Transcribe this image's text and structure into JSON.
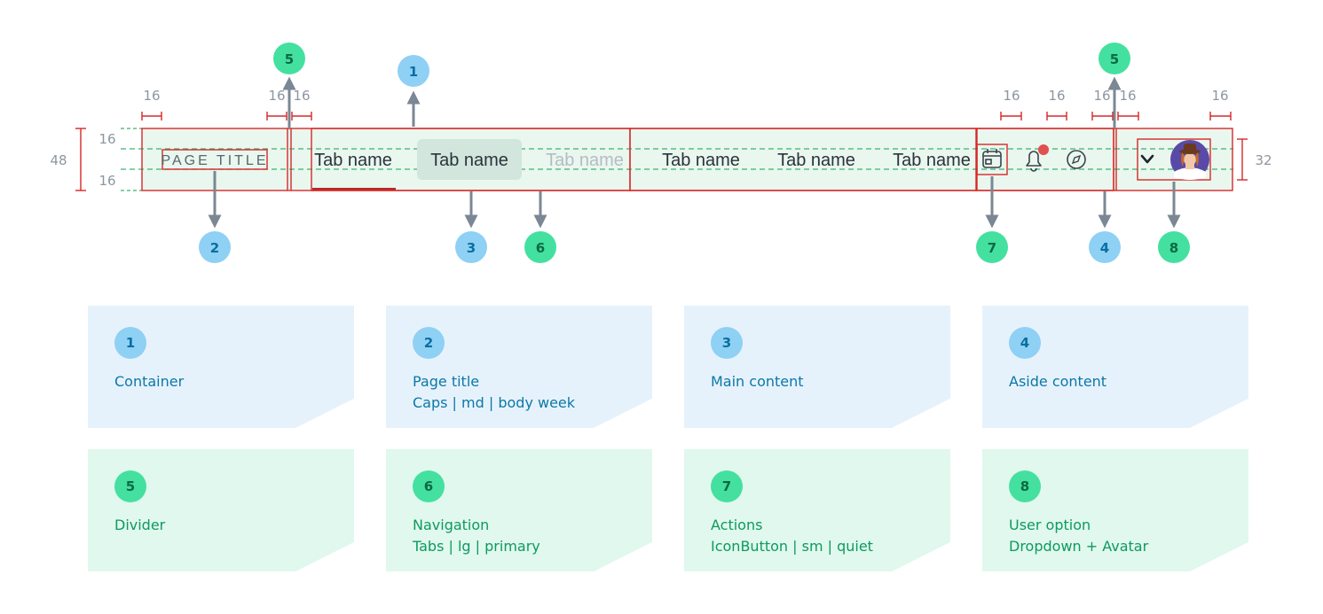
{
  "bar": {
    "page_title": "PAGE TITLE",
    "tabs": [
      {
        "label": "Tab name",
        "state": "selected"
      },
      {
        "label": "Tab name",
        "state": "hover"
      },
      {
        "label": "Tab name",
        "state": "disabled"
      },
      {
        "label": "Tab name",
        "state": "default"
      },
      {
        "label": "Tab name",
        "state": "default"
      },
      {
        "label": "Tab name",
        "state": "default"
      }
    ],
    "icons": [
      "calendar-icon",
      "bell-icon",
      "compass-icon",
      "chevron-down-icon",
      "avatar"
    ]
  },
  "measurements": {
    "height_total": "48",
    "pad_top": "16",
    "pad_bottom": "16",
    "avatar_height": "32",
    "spacing_top": [
      "16",
      "16",
      "16",
      "16",
      "16",
      "16",
      "16",
      "16"
    ]
  },
  "markers": [
    {
      "num": "1",
      "kind": "blue"
    },
    {
      "num": "2",
      "kind": "blue"
    },
    {
      "num": "3",
      "kind": "blue"
    },
    {
      "num": "4",
      "kind": "blue"
    },
    {
      "num": "5",
      "kind": "green"
    },
    {
      "num": "5",
      "kind": "green"
    },
    {
      "num": "6",
      "kind": "green"
    },
    {
      "num": "7",
      "kind": "green"
    },
    {
      "num": "8",
      "kind": "green"
    }
  ],
  "legend": [
    {
      "num": "1",
      "title": "Container",
      "sub": "",
      "kind": "blue"
    },
    {
      "num": "2",
      "title": "Page title",
      "sub": "Caps | md | body week",
      "kind": "blue"
    },
    {
      "num": "3",
      "title": "Main content",
      "sub": "",
      "kind": "blue"
    },
    {
      "num": "4",
      "title": "Aside content",
      "sub": "",
      "kind": "blue"
    },
    {
      "num": "5",
      "title": "Divider",
      "sub": "",
      "kind": "green"
    },
    {
      "num": "6",
      "title": "Navigation",
      "sub": "Tabs | lg | primary",
      "kind": "green"
    },
    {
      "num": "7",
      "title": "Actions",
      "sub": "IconButton | sm | quiet",
      "kind": "green"
    },
    {
      "num": "8",
      "title": "User option",
      "sub": "Dropdown + Avatar",
      "kind": "green"
    }
  ],
  "colors": {
    "outline_red": "#d62828",
    "bar_bg": "#e9f7ee",
    "dash_green": "#3cb371",
    "arrow_grey": "#7b8794",
    "measure_grey": "#8c96a0",
    "blue_badge": "#8fd0f5",
    "green_badge": "#44e0a0"
  }
}
